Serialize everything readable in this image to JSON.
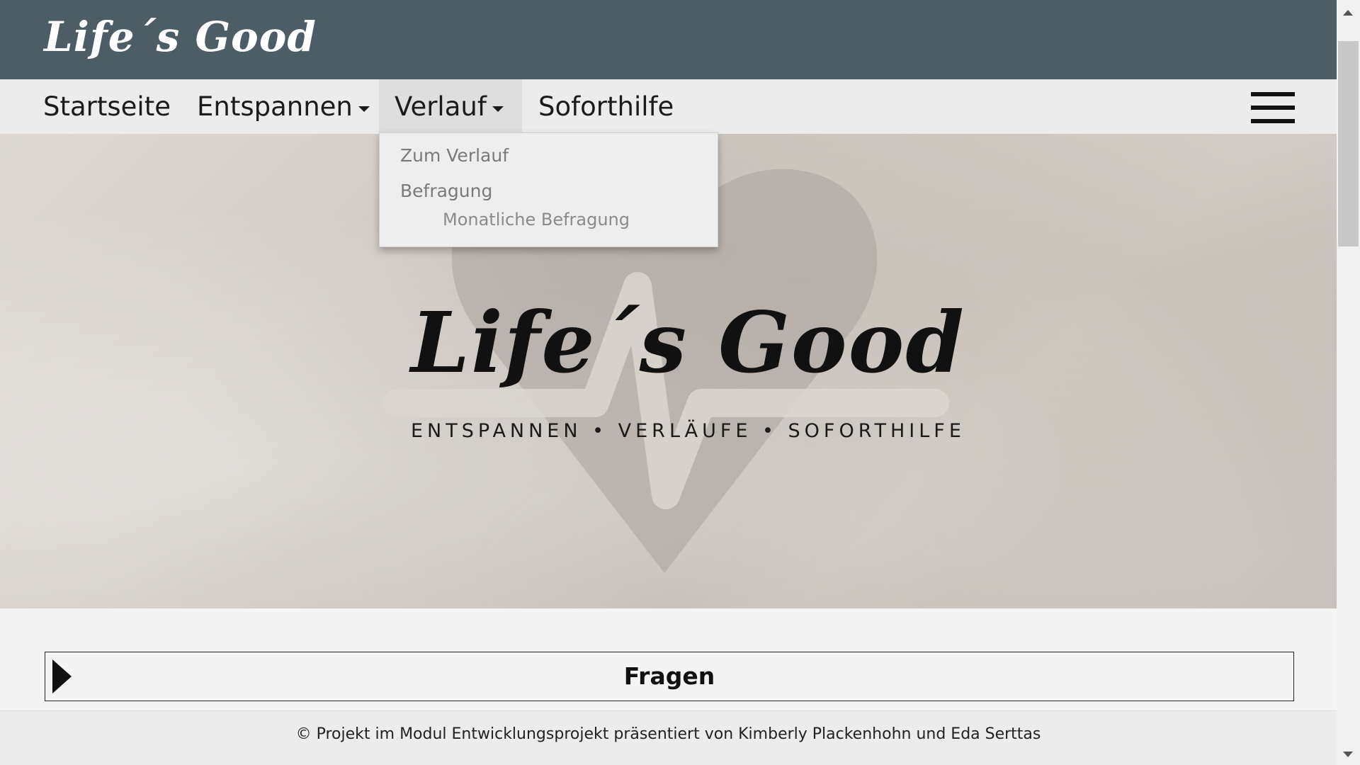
{
  "header": {
    "brand": "Life´s Good"
  },
  "nav": {
    "items": [
      {
        "label": "Startseite",
        "dropdown": false
      },
      {
        "label": "Entspannen",
        "dropdown": true
      },
      {
        "label": "Verlauf",
        "dropdown": true,
        "active": true
      },
      {
        "label": "Soforthilfe",
        "dropdown": false
      }
    ],
    "menu_icon": "hamburger-icon"
  },
  "dropdown": {
    "items": [
      {
        "label": "Zum Verlauf"
      },
      {
        "label": "Befragung"
      },
      {
        "label": "Monatliche Befragung",
        "sub": true
      }
    ]
  },
  "hero": {
    "logo_text": "Life´s Good",
    "tagline": "ENTSPANNEN • VERLÄUFE • SOFORTHILFE",
    "icon": "heart-pulse-icon"
  },
  "accordion": {
    "title": "Fragen",
    "icon": "triangle-right-icon"
  },
  "footer": {
    "text": "© Projekt im Modul Entwicklungsprojekt präsentiert von Kimberly Plackenhohn und Eda Serttas"
  },
  "colors": {
    "header_bg": "#4c5d66",
    "nav_bg": "#ececec",
    "nav_active_bg": "#dedede",
    "dropdown_text": "#7a7a7a"
  }
}
